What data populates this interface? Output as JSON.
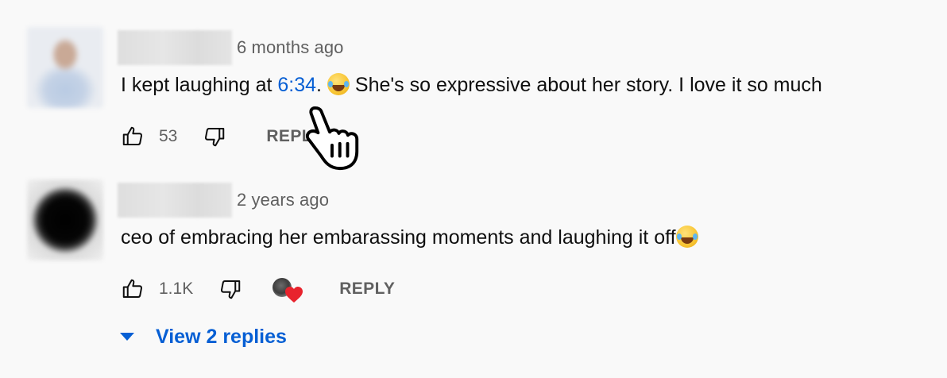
{
  "comments": [
    {
      "time": "6 months ago",
      "text_before": "I kept laughing at ",
      "timestamp": "6:34",
      "text_after": ". ",
      "text_end": " She's so expressive about her story. I love it so much",
      "likes": "53",
      "reply_label": "REPLY",
      "emoji": "rolling-on-floor-laughing"
    },
    {
      "time": "2 years ago",
      "text": "ceo of embracing her embarassing moments and laughing it off",
      "emoji": "face-with-tears-of-joy",
      "likes": "1.1K",
      "reply_label": "REPLY",
      "creator_heart": true
    }
  ],
  "view_replies_label": "View 2 replies",
  "colors": {
    "link": "#065fd4",
    "secondary_text": "#606060",
    "background": "#f9f9f9",
    "heart": "#e8232d"
  }
}
